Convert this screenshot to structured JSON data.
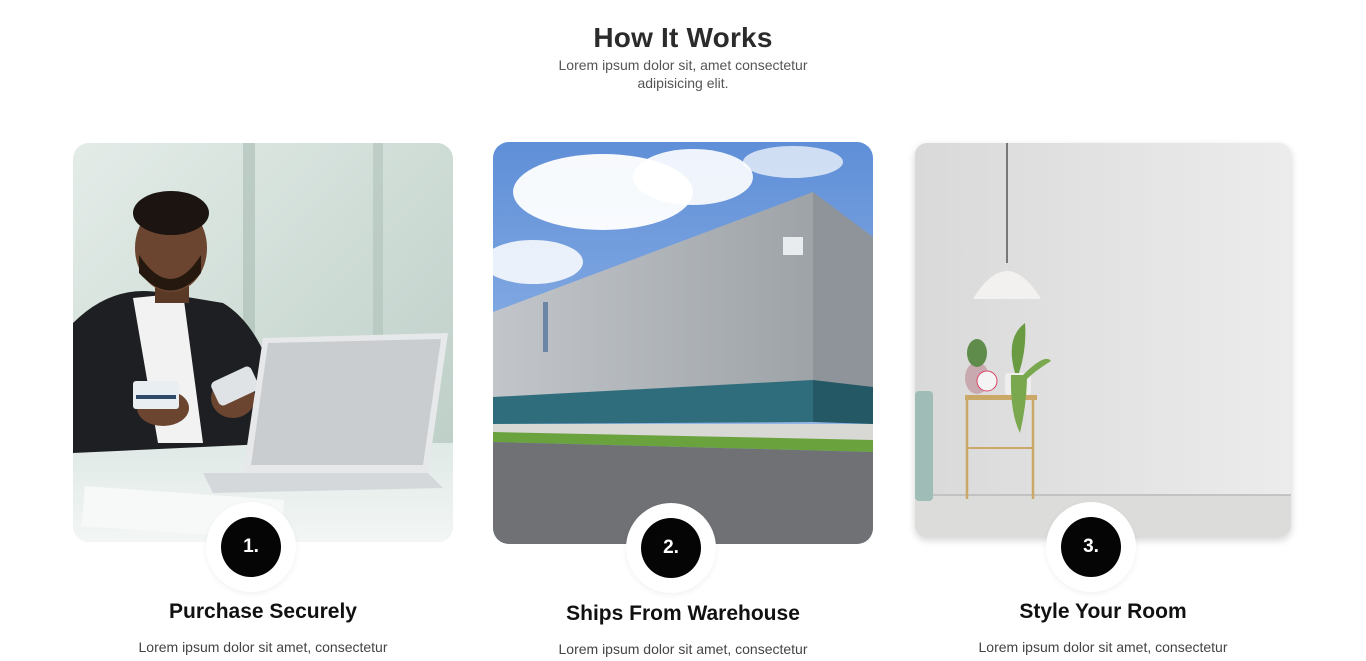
{
  "section": {
    "title": "How It Works",
    "subtitle": "Lorem ipsum dolor sit, amet consectetur adipisicing elit."
  },
  "steps": [
    {
      "number": "1.",
      "title": "Purchase Securely",
      "text": "Lorem ipsum dolor sit amet, consectetur",
      "image": "man-paying-with-card-and-phone-photo"
    },
    {
      "number": "2.",
      "title": "Ships From Warehouse",
      "text": "Lorem ipsum dolor sit amet, consectetur",
      "image": "warehouse-building-photo"
    },
    {
      "number": "3.",
      "title": "Style Your Room",
      "text": "Lorem ipsum dolor sit amet, consectetur",
      "image": "styled-room-with-lamp-and-plants-photo"
    }
  ],
  "colors": {
    "badge_bg": "#050505",
    "badge_text": "#ffffff",
    "heading": "#2b2b2b",
    "body_text": "#444444"
  }
}
